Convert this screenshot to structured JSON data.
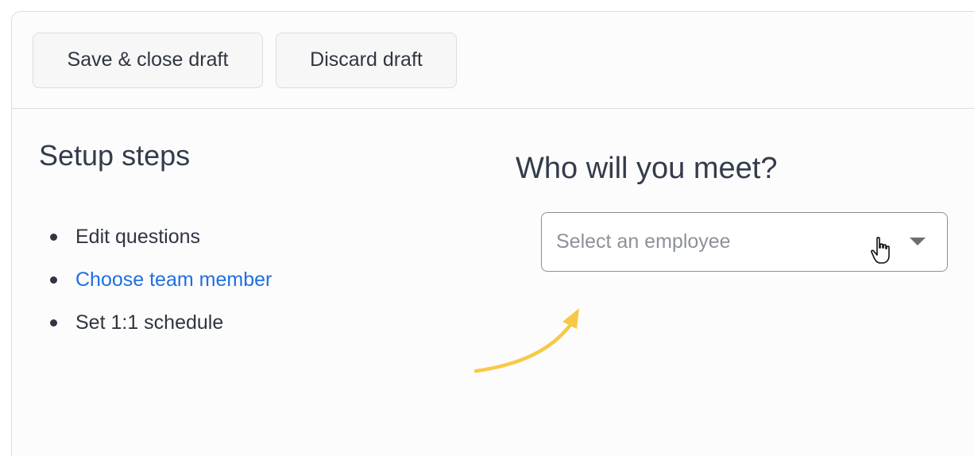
{
  "toolbar": {
    "save_label": "Save & close draft",
    "discard_label": "Discard draft"
  },
  "setup": {
    "title": "Setup steps",
    "steps": [
      {
        "label": "Edit questions",
        "active": false
      },
      {
        "label": "Choose team member",
        "active": true
      },
      {
        "label": "Set 1:1 schedule",
        "active": false
      }
    ]
  },
  "meet": {
    "title": "Who will you meet?",
    "select": {
      "placeholder": "Select an employee",
      "value": ""
    }
  },
  "colors": {
    "link": "#1f6fe0",
    "text": "#2f3542",
    "arrow": "#f7c948"
  },
  "icons": {
    "bullet": "bullet-icon",
    "caret": "chevron-down-icon",
    "cursor": "hand-pointer-icon",
    "annotation": "curved-arrow-icon"
  }
}
